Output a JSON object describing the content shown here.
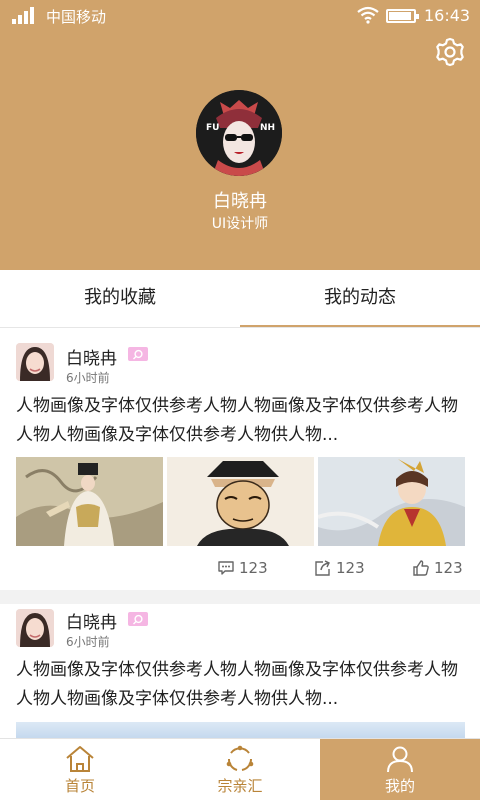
{
  "status_bar": {
    "carrier": "中国移动",
    "time": "16:43",
    "battery_percent": 90
  },
  "profile": {
    "name": "白晓冉",
    "role": "UI设计师"
  },
  "tabs": [
    {
      "label": "我的收藏"
    },
    {
      "label": "我的动态"
    }
  ],
  "posts": [
    {
      "author": "白晓冉",
      "time": "6小时前",
      "text": "人物画像及字体仅供参考人物人物画像及字体仅供参考人物人物人物画像及字体仅供参考人物供人物...",
      "comments": "123",
      "shares": "123",
      "likes": "123"
    },
    {
      "author": "白晓冉",
      "time": "6小时前",
      "text": "人物画像及字体仅供参考人物人物画像及字体仅供参考人物人物人物画像及字体仅供参考人物供人物..."
    }
  ],
  "bottom_nav": [
    {
      "label": "首页"
    },
    {
      "label": "宗亲汇"
    },
    {
      "label": "我的"
    }
  ],
  "colors": {
    "accent": "#d0a36b",
    "nav_text": "#b98438",
    "badge": "#f5b6e3"
  }
}
